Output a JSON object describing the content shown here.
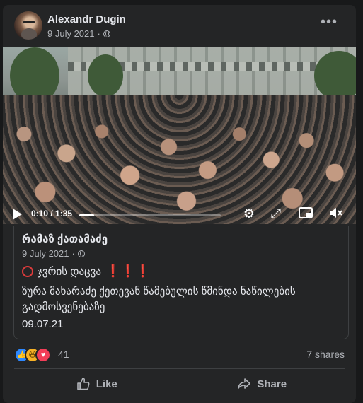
{
  "post": {
    "author": "Alexandr Dugin",
    "date": "9 July 2021",
    "privacy_icon": "globe-icon",
    "menu_icon": "more-options-icon"
  },
  "video": {
    "current_time": "0:10",
    "duration": "1:35",
    "progress": 0.105
  },
  "shared_post": {
    "author": "რამაზ ქათამაძე",
    "date": "9 July 2021",
    "headline": "ჯვრის დაცვა",
    "headline_emphasis": "❗❗❗",
    "body": "ზურა მახარაძე ქეთევან წამებულის წმინდა ნაწილების გადმოსვენებაზე",
    "date_line": "09.07.21"
  },
  "reactions": {
    "count": "41",
    "types": [
      "like",
      "haha",
      "love"
    ],
    "shares": "7 shares"
  },
  "actions": {
    "like_label": "Like",
    "share_label": "Share"
  },
  "colors": {
    "background": "#18191a",
    "card": "#242526",
    "text_primary": "#e4e6eb",
    "text_secondary": "#b0b3b8",
    "like_blue": "#2d88ff",
    "love_red": "#f33e58",
    "haha_yellow": "#f7b125",
    "alert_red": "#e03c3c"
  }
}
